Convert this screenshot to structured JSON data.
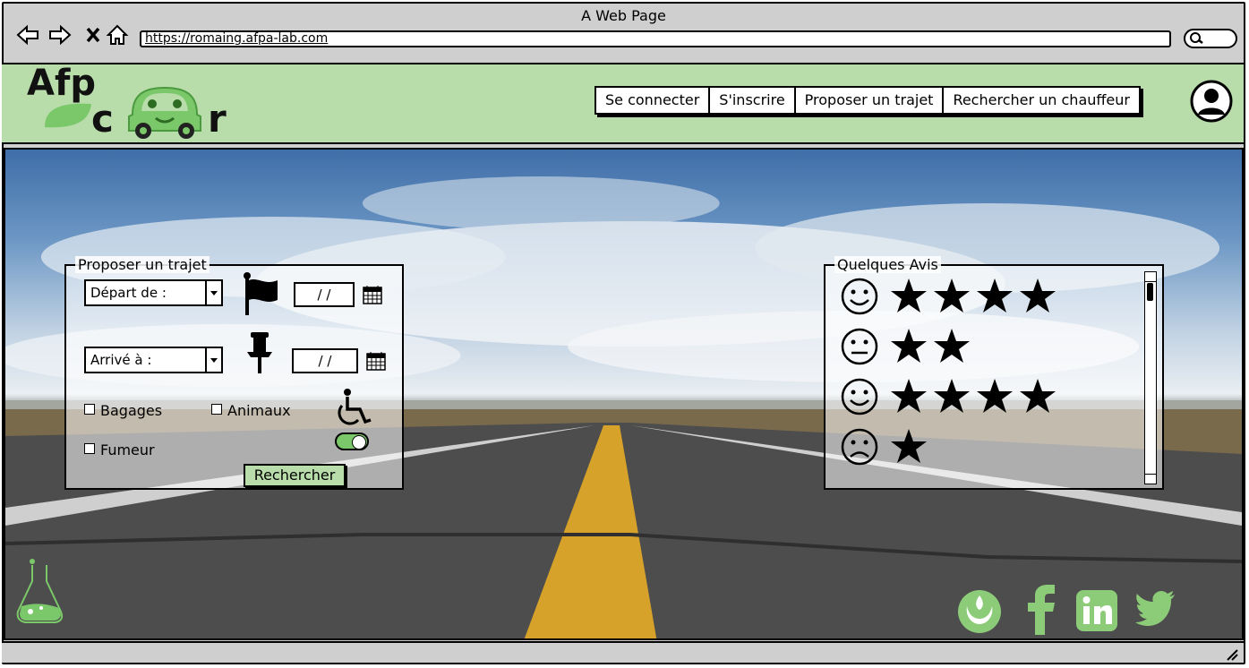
{
  "browser": {
    "title": "A Web Page",
    "url": "https://romaing.afpa-lab.com"
  },
  "header": {
    "logo_top": "Afp",
    "logo_bottom_c": "c",
    "logo_bottom_r": "r",
    "nav": [
      {
        "label": "Se connecter"
      },
      {
        "label": "S'inscrire"
      },
      {
        "label": "Proposer un trajet"
      },
      {
        "label": "Rechercher un chauffeur"
      }
    ]
  },
  "trip_form": {
    "legend": "Proposer un trajet",
    "depart_placeholder": "Départ de :",
    "arrive_placeholder": "Arrivé à :",
    "date1": "/ /",
    "date2": "/ /",
    "options": {
      "bagages": "Bagages",
      "animaux": "Animaux",
      "fumeur": "Fumeur"
    },
    "accessibility_toggle": "on",
    "search_label": "Rechercher"
  },
  "reviews": {
    "legend": "Quelques Avis",
    "items": [
      {
        "mood": "happy",
        "stars": 4
      },
      {
        "mood": "neutral",
        "stars": 2
      },
      {
        "mood": "happy",
        "stars": 4
      },
      {
        "mood": "sad",
        "stars": 1
      }
    ]
  },
  "social": [
    "rebel-alliance-icon",
    "facebook-icon",
    "linkedin-icon",
    "twitter-icon"
  ],
  "colors": {
    "header_green": "#b8dcaa",
    "accent_green": "#7bc86a",
    "social_green": "#8ccc78"
  }
}
